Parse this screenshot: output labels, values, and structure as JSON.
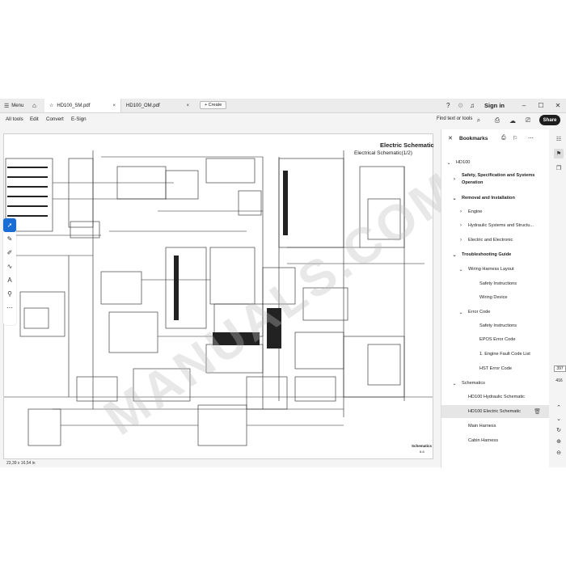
{
  "tabbar": {
    "menu_label": "Menu",
    "tabs": [
      {
        "label": "HD100_SM.pdf",
        "close": "×"
      },
      {
        "label": "HD100_OM.pdf",
        "close": "×"
      }
    ],
    "create_label": "+ Create",
    "signin_label": "Sign in"
  },
  "toolbar": {
    "menus": [
      "All tools",
      "Edit",
      "Convert",
      "E-Sign"
    ],
    "find_label": "Find text or tools",
    "share_label": "Share"
  },
  "document": {
    "title": "Electric Schematic",
    "subtitle": "Electrical Schematic(1/2)",
    "footer_section": "Schematics",
    "footer_page": "6-6",
    "watermark": "MANUALS.COM",
    "page_size": "23,39 x 16,54 in"
  },
  "bookmarks": {
    "header": "Bookmarks",
    "items": [
      {
        "label": "HD100",
        "chev": "⌄",
        "level": 0,
        "bold": false
      },
      {
        "label": "Safety, Specification and Systems",
        "label2": "Operation",
        "chev": "›",
        "level": 1,
        "bold": true
      },
      {
        "label": "Removal and Installation",
        "chev": "⌄",
        "level": 1,
        "bold": true
      },
      {
        "label": "Engine",
        "chev": "›",
        "level": 2,
        "bold": false
      },
      {
        "label": "Hydraulic Systems and Structu...",
        "chev": "›",
        "level": 2,
        "bold": false
      },
      {
        "label": "Electric and Electronic",
        "chev": "›",
        "level": 2,
        "bold": false
      },
      {
        "label": "Troubleshooting Guide",
        "chev": "⌄",
        "level": 1,
        "bold": true
      },
      {
        "label": "Wiring Harness Layout",
        "chev": "⌄",
        "level": 2,
        "bold": false
      },
      {
        "label": "Safety Instructions",
        "chev": "",
        "level": 3,
        "bold": false
      },
      {
        "label": "Wiring Device",
        "chev": "",
        "level": 3,
        "bold": false
      },
      {
        "label": "Error Code",
        "chev": "⌄",
        "level": 2,
        "bold": false
      },
      {
        "label": "Safety Instructions",
        "chev": "",
        "level": 3,
        "bold": false
      },
      {
        "label": "EPOS Error Code",
        "chev": "",
        "level": 3,
        "bold": false
      },
      {
        "label": "1. Engine Fault Code List",
        "chev": "",
        "level": 3,
        "bold": false
      },
      {
        "label": "HST Error Code",
        "chev": "",
        "level": 3,
        "bold": false
      },
      {
        "label": "Schematics",
        "chev": "⌄",
        "level": 1,
        "bold": false
      },
      {
        "label": "HD100 Hydraulic Schematic",
        "chev": "",
        "level": 2,
        "bold": false
      },
      {
        "label": "HD100 Electric Schematic",
        "chev": "",
        "level": 2,
        "bold": false,
        "selected": true
      },
      {
        "label": "Main Harness",
        "chev": "",
        "level": 2,
        "bold": false
      },
      {
        "label": "Cabin Harness",
        "chev": "",
        "level": 2,
        "bold": false
      }
    ]
  },
  "pagination": {
    "current": "397",
    "total": "416"
  },
  "colors": {
    "accent": "#1a6dd4",
    "share_bg": "#1d1d1d",
    "selected_bg": "#e6e6e6"
  }
}
